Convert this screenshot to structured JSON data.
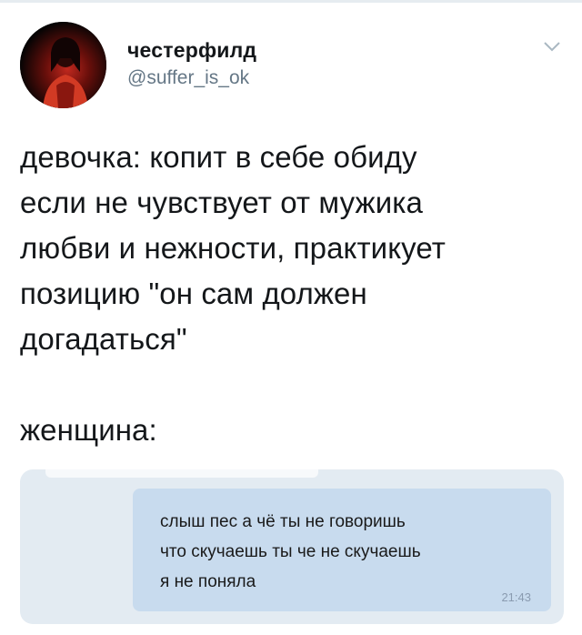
{
  "tweet": {
    "author": {
      "display_name": "честерфилд",
      "handle": "@suffer_is_ok",
      "avatar_icon": "profile-photo-avatar"
    },
    "menu_icon": "chevron-down-icon",
    "text": "девочка: копит в себе обиду\nесли не чувствует от мужика\nлюбви и нежности, практикует\nпозицию \"он сам должен\nдогадаться\"\n\nженщина:"
  },
  "attached_image": {
    "message": {
      "text": "слыш пес а чё ты не говоришь\nчто скучаешь ты че не скучаешь\nя не поняла",
      "time": "21:43"
    }
  },
  "colors": {
    "handle": "#657786",
    "media_background": "#e3ebf2",
    "bubble_background": "#c8dbee",
    "time_text": "#8a9bb0"
  }
}
